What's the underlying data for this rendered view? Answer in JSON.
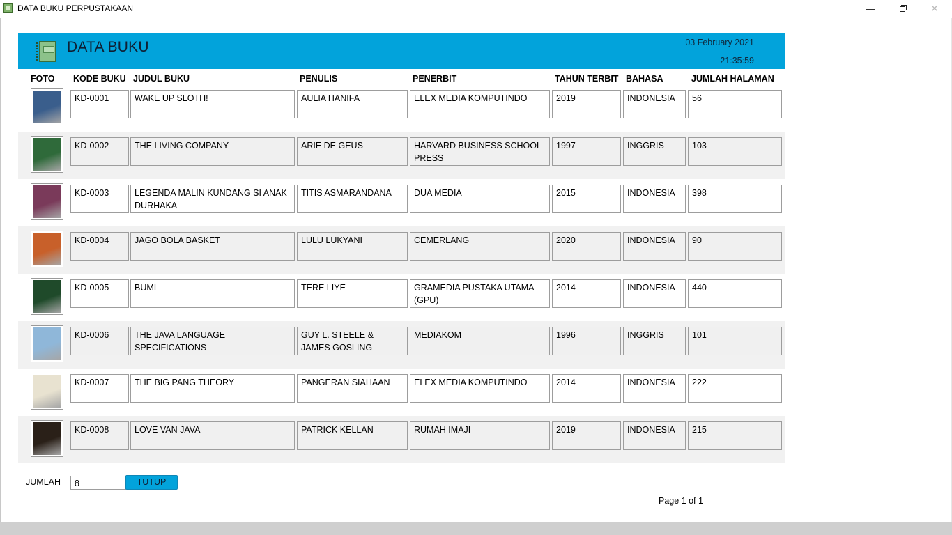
{
  "window": {
    "title": "DATA BUKU PERPUSTAKAAN",
    "minimize_glyph": "—",
    "close_glyph": "✕"
  },
  "header": {
    "title": "DATA BUKU",
    "date": "03 February 2021",
    "time": "21:35:59",
    "background_color": "#02a3db"
  },
  "columns": {
    "foto": "FOTO",
    "kode": "KODE BUKU",
    "judul": "JUDUL BUKU",
    "penulis": "PENULIS",
    "penerbit": "PENERBIT",
    "tahun": "TAHUN TERBIT",
    "bahasa": "BAHASA",
    "jumlah": "JUMLAH HALAMAN"
  },
  "rows": [
    {
      "kode": "KD-0001",
      "judul": "WAKE UP SLOTH!",
      "penulis": "AULIA HANIFA",
      "penerbit": "ELEX MEDIA KOMPUTINDO",
      "tahun": "2019",
      "bahasa": "INDONESIA",
      "jumlah": "56",
      "cover_icon": "book-cover-wake-up-sloth",
      "cover_color": "#3a5e8c"
    },
    {
      "kode": "KD-0002",
      "judul": "THE LIVING COMPANY",
      "penulis": "ARIE DE GEUS",
      "penerbit": "HARVARD BUSINESS SCHOOL PRESS",
      "tahun": "1997",
      "bahasa": "INGGRIS",
      "jumlah": "103",
      "cover_icon": "book-cover-living-company",
      "cover_color": "#2f6a3a"
    },
    {
      "kode": "KD-0003",
      "judul": "LEGENDA MALIN KUNDANG SI ANAK DURHAKA",
      "penulis": "TITIS ASMARANDANA",
      "penerbit": "DUA MEDIA",
      "tahun": "2015",
      "bahasa": "INDONESIA",
      "jumlah": "398",
      "cover_icon": "book-cover-malin-kundang",
      "cover_color": "#7a3a5a"
    },
    {
      "kode": "KD-0004",
      "judul": "JAGO BOLA BASKET",
      "penulis": "LULU LUKYANI",
      "penerbit": "CEMERLANG",
      "tahun": "2020",
      "bahasa": "INDONESIA",
      "jumlah": "90",
      "cover_icon": "book-cover-jago-bola-basket",
      "cover_color": "#c8602a"
    },
    {
      "kode": "KD-0005",
      "judul": "BUMI",
      "penulis": "TERE LIYE",
      "penerbit": "GRAMEDIA PUSTAKA UTAMA (GPU)",
      "tahun": "2014",
      "bahasa": "INDONESIA",
      "jumlah": "440",
      "cover_icon": "book-cover-bumi",
      "cover_color": "#1f4a2a"
    },
    {
      "kode": "KD-0006",
      "judul": "THE JAVA LANGUAGE SPECIFICATIONS",
      "penulis": "GUY L. STEELE & JAMES GOSLING",
      "penerbit": "MEDIAKOM",
      "tahun": "1996",
      "bahasa": "INGGRIS",
      "jumlah": "101",
      "cover_icon": "book-cover-java-language",
      "cover_color": "#8fb7d9"
    },
    {
      "kode": "KD-0007",
      "judul": "THE BIG PANG THEORY",
      "penulis": "PANGERAN SIAHAAN",
      "penerbit": "ELEX MEDIA KOMPUTINDO",
      "tahun": "2014",
      "bahasa": "INDONESIA",
      "jumlah": "222",
      "cover_icon": "book-cover-big-pang-theory",
      "cover_color": "#e8e2d0"
    },
    {
      "kode": "KD-0008",
      "judul": "LOVE VAN JAVA",
      "penulis": "PATRICK KELLAN",
      "penerbit": "RUMAH IMAJI",
      "tahun": "2019",
      "bahasa": "INDONESIA",
      "jumlah": "215",
      "cover_icon": "book-cover-love-van-java",
      "cover_color": "#2a2018"
    }
  ],
  "footer": {
    "jumlah_label": "JUMLAH =",
    "jumlah_value": "8",
    "tutup_label": "TUTUP",
    "page_info": "Page 1 of 1"
  }
}
